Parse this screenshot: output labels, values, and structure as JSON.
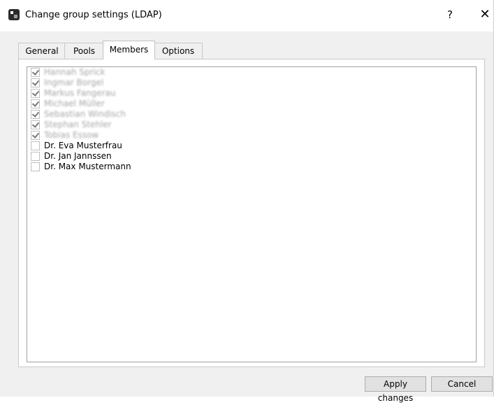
{
  "window": {
    "title": "Change group settings (LDAP)",
    "help": "?",
    "close": "✕"
  },
  "tabs": [
    {
      "label": "General"
    },
    {
      "label": "Pools"
    },
    {
      "label": "Members"
    },
    {
      "label": "Options"
    }
  ],
  "members": [
    {
      "name": "Hannah Sprick",
      "checked": true,
      "blurred": true
    },
    {
      "name": "Ingmar Borgel",
      "checked": true,
      "blurred": true
    },
    {
      "name": "Markus Fangerau",
      "checked": true,
      "blurred": true
    },
    {
      "name": "Michael Müller",
      "checked": true,
      "blurred": true
    },
    {
      "name": "Sebastian Windisch",
      "checked": true,
      "blurred": true
    },
    {
      "name": "Stephan Stehler",
      "checked": true,
      "blurred": true
    },
    {
      "name": "Tobias Essow",
      "checked": true,
      "blurred": true
    },
    {
      "name": "Dr. Eva Musterfrau",
      "checked": false,
      "blurred": false
    },
    {
      "name": "Dr. Jan Jannssen",
      "checked": false,
      "blurred": false
    },
    {
      "name": "Dr. Max Mustermann",
      "checked": false,
      "blurred": false
    }
  ],
  "buttons": {
    "apply": "Apply changes",
    "cancel": "Cancel"
  }
}
